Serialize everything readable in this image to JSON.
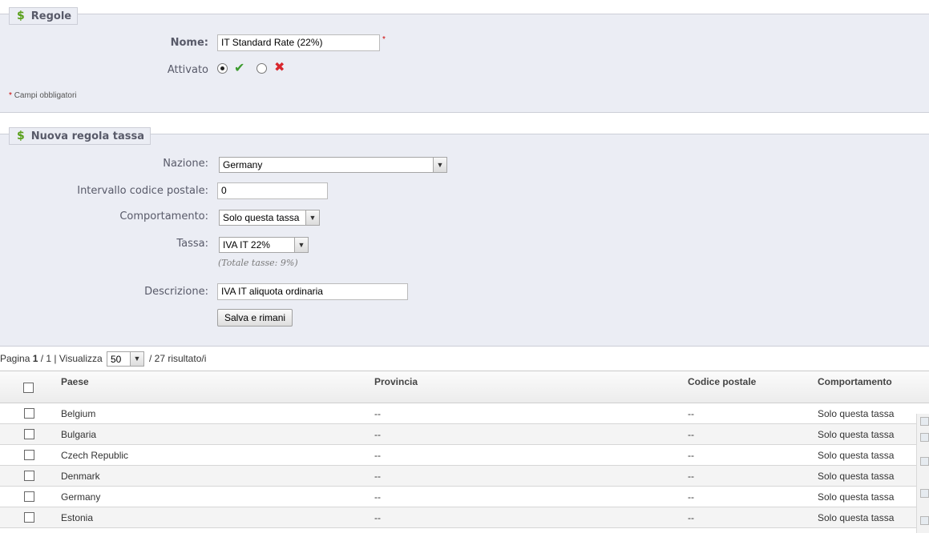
{
  "regole": {
    "legend": "Regole",
    "nome_label": "Nome:",
    "nome_value": "IT Standard Rate (22%)",
    "required_mark": "*",
    "attivato_label": "Attivato",
    "required_note_mark": "*",
    "required_note": "Campi obbligatori"
  },
  "nuova": {
    "legend": "Nuova regola tassa",
    "nazione_label": "Nazione:",
    "nazione_value": "Germany",
    "postal_label": "Intervallo codice postale:",
    "postal_value": "0",
    "comportamento_label": "Comportamento:",
    "comportamento_value": "Solo questa tassa",
    "tassa_label": "Tassa:",
    "tassa_value": "IVA IT 22%",
    "totale_hint": "(Totale tasse: 9%)",
    "descrizione_label": "Descrizione:",
    "descrizione_value": "IVA IT aliquota ordinaria",
    "save_button": "Salva e rimani"
  },
  "pagination": {
    "pagina_label": "Pagina",
    "current_page": "1",
    "of_pages": "/ 1 | Visualizza",
    "per_page": "50",
    "results": "/ 27 risultato/i"
  },
  "table": {
    "headers": [
      "Paese",
      "Provincia",
      "Codice postale",
      "Comportamento"
    ],
    "rows": [
      [
        "Belgium",
        "--",
        "--",
        "Solo questa tassa"
      ],
      [
        "Bulgaria",
        "--",
        "--",
        "Solo questa tassa"
      ],
      [
        "Czech Republic",
        "--",
        "--",
        "Solo questa tassa"
      ],
      [
        "Denmark",
        "--",
        "--",
        "Solo questa tassa"
      ],
      [
        "Germany",
        "--",
        "--",
        "Solo questa tassa"
      ],
      [
        "Estonia",
        "--",
        "--",
        "Solo questa tassa"
      ]
    ]
  },
  "icons": {
    "dollar": "$",
    "check": "✔",
    "cross": "✖",
    "dropdown": "▼"
  },
  "colors": {
    "check": "#3d9b2f",
    "cross": "#d8262d",
    "dollar": "#5aa01c"
  }
}
